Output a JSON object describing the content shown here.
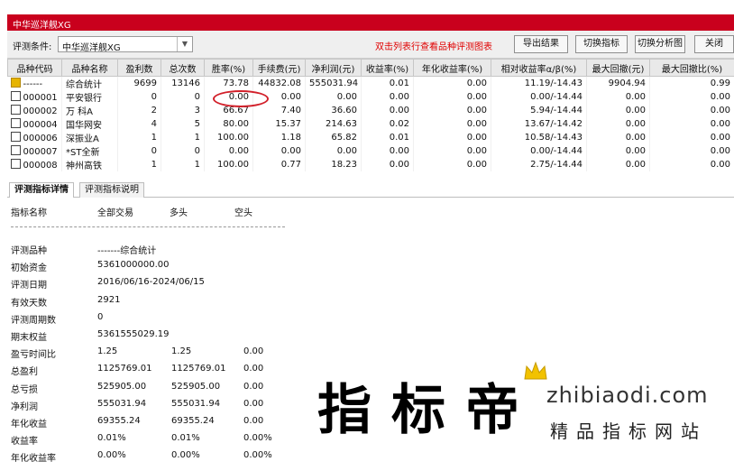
{
  "window": {
    "title": "中华巡洋舰XG"
  },
  "toolbar": {
    "criteria_label": "评测条件:",
    "criteria_value": "中华巡洋舰XG",
    "hint": "双击列表行查看品种评测图表",
    "export_label": "导出结果",
    "switch_indicator_label": "切换指标",
    "switch_chart_label": "切换分析图",
    "close_label": "关闭"
  },
  "table": {
    "headers": [
      "品种代码",
      "品种名称",
      "盈利数",
      "总次数",
      "胜率(%)",
      "手续费(元)",
      "净利润(元)",
      "收益率(%)",
      "年化收益率(%)",
      "相对收益率α/β(%)",
      "最大回撤(元)",
      "最大回撤比(%)"
    ],
    "rows": [
      {
        "code": "------",
        "name": "综合统计",
        "wins": "9699",
        "total": "13146",
        "winrate": "73.78",
        "fee": "44832.08",
        "profit": "555031.94",
        "ret": "0.01",
        "annual": "0.00",
        "relative": "11.19/-14.43",
        "maxdd": "9904.94",
        "maxddr": "0.99",
        "icon": "folder"
      },
      {
        "code": "000001",
        "name": "平安银行",
        "wins": "0",
        "total": "0",
        "winrate": "0.00",
        "fee": "0.00",
        "profit": "0.00",
        "ret": "0.00",
        "annual": "0.00",
        "relative": "0.00/-14.44",
        "maxdd": "0.00",
        "maxddr": "0.00",
        "icon": "box"
      },
      {
        "code": "000002",
        "name": "万 科A",
        "wins": "2",
        "total": "3",
        "winrate": "66.67",
        "fee": "7.40",
        "profit": "36.60",
        "ret": "0.00",
        "annual": "0.00",
        "relative": "5.94/-14.44",
        "maxdd": "0.00",
        "maxddr": "0.00",
        "icon": "box"
      },
      {
        "code": "000004",
        "name": "国华网安",
        "wins": "4",
        "total": "5",
        "winrate": "80.00",
        "fee": "15.37",
        "profit": "214.63",
        "ret": "0.02",
        "annual": "0.00",
        "relative": "13.67/-14.42",
        "maxdd": "0.00",
        "maxddr": "0.00",
        "icon": "box"
      },
      {
        "code": "000006",
        "name": "深振业A",
        "wins": "1",
        "total": "1",
        "winrate": "100.00",
        "fee": "1.18",
        "profit": "65.82",
        "ret": "0.01",
        "annual": "0.00",
        "relative": "10.58/-14.43",
        "maxdd": "0.00",
        "maxddr": "0.00",
        "icon": "box"
      },
      {
        "code": "000007",
        "name": "*ST全新",
        "wins": "0",
        "total": "0",
        "winrate": "0.00",
        "fee": "0.00",
        "profit": "0.00",
        "ret": "0.00",
        "annual": "0.00",
        "relative": "0.00/-14.44",
        "maxdd": "0.00",
        "maxddr": "0.00",
        "icon": "box"
      },
      {
        "code": "000008",
        "name": "神州高铁",
        "wins": "1",
        "total": "1",
        "winrate": "100.00",
        "fee": "0.77",
        "profit": "18.23",
        "ret": "0.00",
        "annual": "0.00",
        "relative": "2.75/-14.44",
        "maxdd": "0.00",
        "maxddr": "0.00",
        "icon": "box"
      }
    ]
  },
  "tabs": {
    "detail": "评测指标详情",
    "explain": "评测指标说明"
  },
  "detail": {
    "headers": {
      "name": "指标名称",
      "all": "全部交易",
      "long": "多头",
      "short": "空头"
    },
    "rows": [
      {
        "label": "评测品种",
        "v1": "-------综合统计",
        "v2": "",
        "v3": ""
      },
      {
        "label": "初始资金",
        "v1": "5361000000.00",
        "v2": "",
        "v3": ""
      },
      {
        "label": "评测日期",
        "v1": "2016/06/16-2024/06/15",
        "v2": "",
        "v3": ""
      },
      {
        "label": "有效天数",
        "v1": "2921",
        "v2": "",
        "v3": ""
      },
      {
        "label": "评测周期数",
        "v1": "0",
        "v2": "",
        "v3": ""
      },
      {
        "label": "期末权益",
        "v1": "5361555029.19",
        "v2": "",
        "v3": ""
      },
      {
        "label": "盈亏时间比",
        "v1": "1.25",
        "v2": "1.25",
        "v3": "0.00"
      },
      {
        "label": "总盈利",
        "v1": "1125769.01",
        "v2": "1125769.01",
        "v3": "0.00"
      },
      {
        "label": "总亏损",
        "v1": "525905.00",
        "v2": "525905.00",
        "v3": "0.00"
      },
      {
        "label": "净利润",
        "v1": "555031.94",
        "v2": "555031.94",
        "v3": "0.00"
      },
      {
        "label": "年化收益",
        "v1": "69355.24",
        "v2": "69355.24",
        "v3": "0.00"
      },
      {
        "label": "收益率",
        "v1": "0.01%",
        "v2": "0.01%",
        "v3": "0.00%"
      },
      {
        "label": "年化收益率",
        "v1": "0.00%",
        "v2": "0.00%",
        "v3": "0.00%"
      }
    ]
  },
  "watermark": {
    "big": "指标帝",
    "url": "zhibiaodi.com",
    "sub": "精品指标网站"
  },
  "colors": {
    "titlebar": "#c9001d",
    "hint": "#e00000",
    "highlight_circle": "#d2202a"
  }
}
